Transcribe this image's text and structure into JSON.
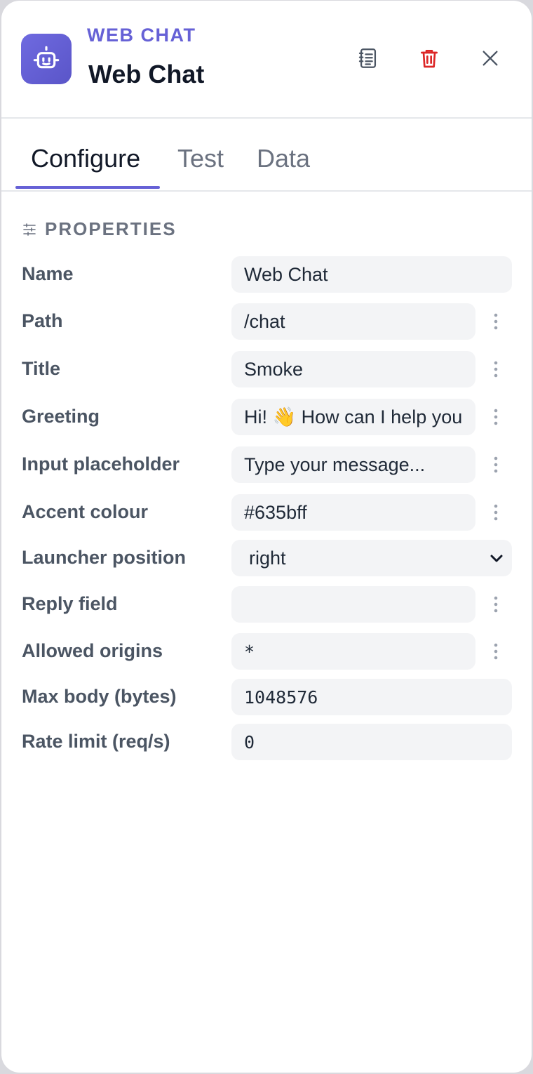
{
  "header": {
    "kind_label": "WEB CHAT",
    "title": "Web Chat",
    "accent_color": "#6661d6",
    "icons": {
      "app": "robot-icon",
      "docs": "notebook-icon",
      "delete": "trash-icon",
      "close": "close-icon"
    },
    "delete_color": "#dc2626"
  },
  "tabs": [
    {
      "label": "Configure",
      "active": true
    },
    {
      "label": "Test",
      "active": false
    },
    {
      "label": "Data",
      "active": false
    }
  ],
  "section": {
    "title": "PROPERTIES",
    "icon": "sliders-icon"
  },
  "fields": {
    "name": {
      "label": "Name",
      "value": "Web Chat"
    },
    "path": {
      "label": "Path",
      "value": "/chat"
    },
    "title": {
      "label": "Title",
      "value": "Smoke"
    },
    "greeting": {
      "label": "Greeting",
      "value": "Hi! 👋 How can I help you"
    },
    "input_placeholder": {
      "label": "Input placeholder",
      "value": "Type your message..."
    },
    "accent_colour": {
      "label": "Accent colour",
      "value": "#635bff"
    },
    "launcher_position": {
      "label": "Launcher position",
      "value": "right"
    },
    "reply_field": {
      "label": "Reply field",
      "value": ""
    },
    "allowed_origins": {
      "label": "Allowed origins",
      "value": "*"
    },
    "max_body": {
      "label": "Max body (bytes)",
      "value": "1048576"
    },
    "rate_limit": {
      "label": "Rate limit (req/s)",
      "value": "0"
    }
  }
}
